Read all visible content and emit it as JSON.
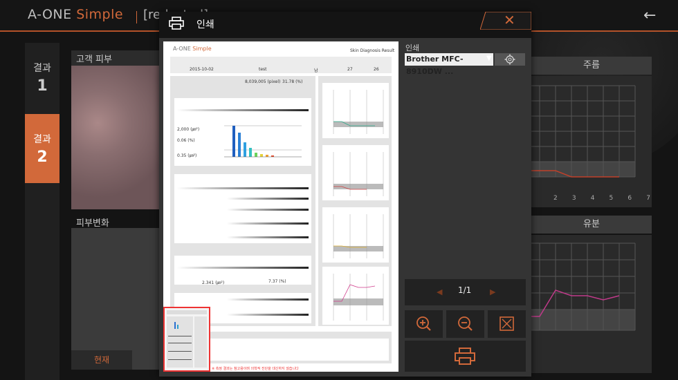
{
  "app": {
    "brand_main": "A-ONE",
    "brand_sub": "Simple",
    "header_fragment": "[redacted]"
  },
  "background": {
    "results": [
      {
        "label": "결과",
        "number": "1"
      },
      {
        "label": "결과",
        "number": "2"
      }
    ],
    "customer_skin_label": "고객 피부",
    "skin_change_label": "피부변화",
    "current_button": "현재",
    "chart_wrinkle_label": "주름",
    "chart_oil_label": "유분",
    "x_ticks": [
      "2",
      "3",
      "4",
      "5",
      "6",
      "7"
    ]
  },
  "dialog": {
    "title": "인쇄",
    "printer_label": "인쇄",
    "printer_name": "Brother MFC-8910DW ...",
    "page_indicator": "1/1"
  },
  "preview": {
    "brand_main": "A-ONE",
    "brand_sub": "Simple",
    "report_title": "Skin Diagnosis Result",
    "date": "2015-10-02",
    "name": "test",
    "gender": "남",
    "age": "27",
    "value": "26",
    "total_count": "8,039,005 (pixel)",
    "total_pct": "31.78 (%)",
    "pore_size": "2,000 (㎛²)",
    "pore_pct": "0.06 (%)",
    "pore_size2": "0.35 (㎛²)",
    "pigment_val": "2.341 (㎛²)",
    "pigment_pct": "7.37 (%)",
    "footer_warning": "※ 측정 결과는 참고용이며 의학적 진단을 대신하지 않습니다"
  },
  "colors": {
    "accent": "#d2693a",
    "dialog_bg": "#343434",
    "app_bg": "#141414"
  }
}
